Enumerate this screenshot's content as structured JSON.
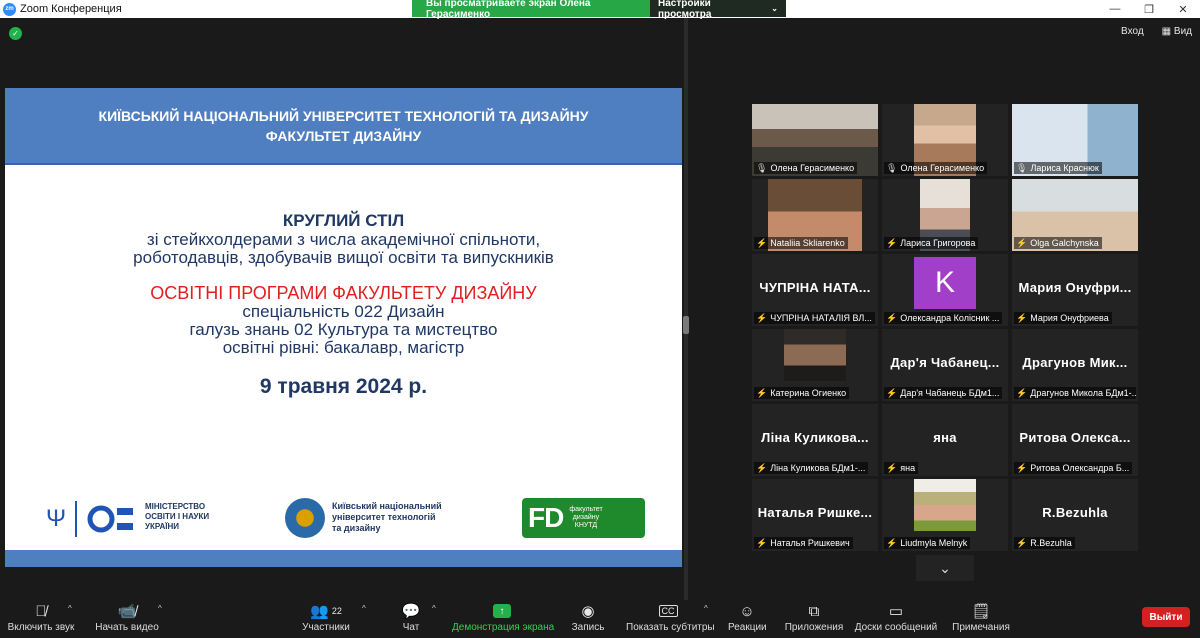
{
  "window": {
    "title": "Zoom Конференция",
    "share_message": "Вы просматриваете экран Олена Герасименко",
    "view_options": "Настройки просмотра"
  },
  "top_right": {
    "exit_fullscreen": "Вход",
    "view": "Вид"
  },
  "slide": {
    "header_line1": "КИЇВСЬКИЙ НАЦІОНАЛЬНИЙ УНІВЕРСИТЕТ  ТЕХНОЛОГІЙ ТА ДИЗАЙНУ",
    "header_line2": "ФАКУЛЬТЕТ  ДИЗАЙНУ",
    "title": "КРУГЛИЙ СТІЛ",
    "line1": "зі стейкхолдерами з числа академічної спільноти,",
    "line2": "роботодавців, здобувачів вищої освіти та випускників",
    "program": "ОСВІТНІ ПРОГРАМИ ФАКУЛЬТЕТУ ДИЗАЙНУ",
    "spec": "спеціальність 022 Дизайн",
    "field": "галузь знань 02 Культура та мистецтво",
    "levels": "освітні рівні: бакалавр, магістр",
    "date": "9 травня 2024 р.",
    "mon_line1": "МІНІСТЕРСТВО",
    "mon_line2": "ОСВІТИ І НАУКИ",
    "mon_line3": "УКРАЇНИ",
    "knutd_line1": "Київський національний",
    "knutd_line2": "університет технологій",
    "knutd_line3": "та дизайну",
    "fd_mark": "FD",
    "fd_line1": "факультет",
    "fd_line2": "дизайну",
    "fd_line3": "КНУТД"
  },
  "participants": [
    {
      "name": "Олена Герасименко",
      "big": "",
      "muted": false
    },
    {
      "name": "Олена Герасименко",
      "big": "",
      "muted": false
    },
    {
      "name": "Лариса Краснюк",
      "big": "",
      "muted": false
    },
    {
      "name": "Nataliia Skliarenko",
      "big": "",
      "muted": true
    },
    {
      "name": "Лариса Григорова",
      "big": "",
      "muted": true
    },
    {
      "name": "Olga Galchynska",
      "big": "",
      "muted": true
    },
    {
      "name": "ЧУПРІНА НАТАЛІЯ ВЛ...",
      "big": "ЧУПРІНА  НАТА...",
      "muted": true
    },
    {
      "name": "Олександра Колісник ...",
      "big": "",
      "muted": true,
      "avatar": "K"
    },
    {
      "name": "Мария Онуфриева",
      "big": "Мария  Онуфри...",
      "muted": true
    },
    {
      "name": "Катерина Огиенко",
      "big": "",
      "muted": true
    },
    {
      "name": "Дар'я Чабанець БДм1...",
      "big": "Дар'я  Чабанец...",
      "muted": true
    },
    {
      "name": "Драгунов Микола БДм1-...",
      "big": "Драгунов  Мик...",
      "muted": true
    },
    {
      "name": "Ліна Куликова БДм1-...",
      "big": "Ліна  Куликова...",
      "muted": true
    },
    {
      "name": "яна",
      "big": "яна",
      "muted": true
    },
    {
      "name": "Ритова Олександра Б...",
      "big": "Ритова  Олекса...",
      "muted": true
    },
    {
      "name": "Наталья Ришкевич",
      "big": "Наталья  Ришке...",
      "muted": true
    },
    {
      "name": "Liudmyla Melnyk",
      "big": "",
      "muted": true
    },
    {
      "name": "R.Bezuhla",
      "big": "R.Bezuhla",
      "muted": true
    }
  ],
  "toolbar": {
    "audio": "Включить звук",
    "video": "Начать видео",
    "participants": "Участники",
    "participants_count": "22",
    "chat": "Чат",
    "share": "Демонстрация экрана",
    "record": "Запись",
    "captions": "Показать субтитры",
    "reactions": "Реакции",
    "apps": "Приложения",
    "whiteboards": "Доски сообщений",
    "notes": "Примечания",
    "leave": "Выйти"
  },
  "icons": [
    "zoom-logo-icon",
    "shield-icon",
    "mic-muted-icon",
    "video-off-icon",
    "participants-icon",
    "chat-icon",
    "share-screen-icon",
    "record-icon",
    "cc-icon",
    "reactions-icon",
    "apps-icon",
    "whiteboard-icon",
    "notes-icon",
    "chevron-down-icon"
  ],
  "colors": {
    "accent": "#22b24c",
    "leave": "#d32020",
    "active_speaker": "#b9e13a",
    "slide_header": "#4f7fc0"
  }
}
